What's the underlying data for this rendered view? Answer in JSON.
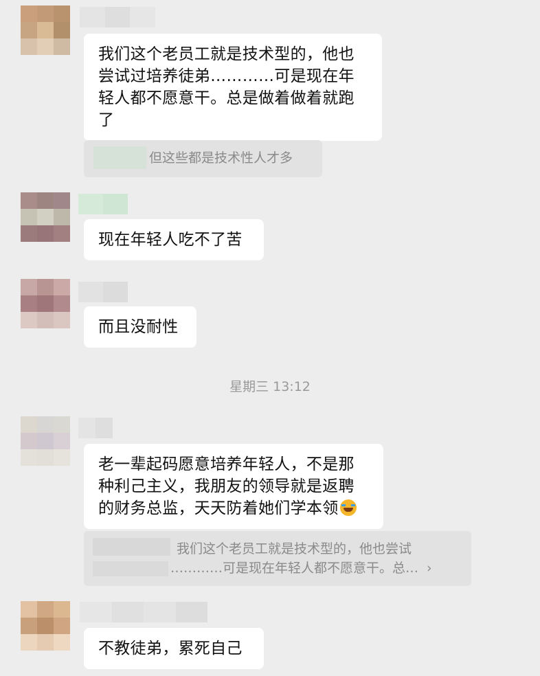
{
  "messages": [
    {
      "text": "我们这个老员工就是技术型的，他也尝试过培养徒弟…………可是现在年轻人都不愿意干。总是做着做着就跑了",
      "quote": {
        "text": "但这些都是技术性人才多"
      }
    },
    {
      "text": "现在年轻人吃不了苦"
    },
    {
      "text": "而且没耐性"
    },
    {
      "text": "老一辈起码愿意培养年轻人，不是那种利己主义，我朋友的领导就是返聘的财务总监，天天防着她们学本领",
      "emoji": "grinning-tears-emoji",
      "quote": {
        "line1": "我们这个老员工就是技术型的，他也尝试",
        "line2": "…………可是现在年轻人都不愿意干。总…"
      }
    },
    {
      "text": "不教徒弟，累死自己"
    }
  ],
  "timestamp": "星期三 13:12",
  "colors": {
    "background": "#ededed",
    "bubble": "#ffffff",
    "quote_bg": "#e2e2e2",
    "quote_text": "#8a8a8a",
    "timestamp": "#999999"
  }
}
